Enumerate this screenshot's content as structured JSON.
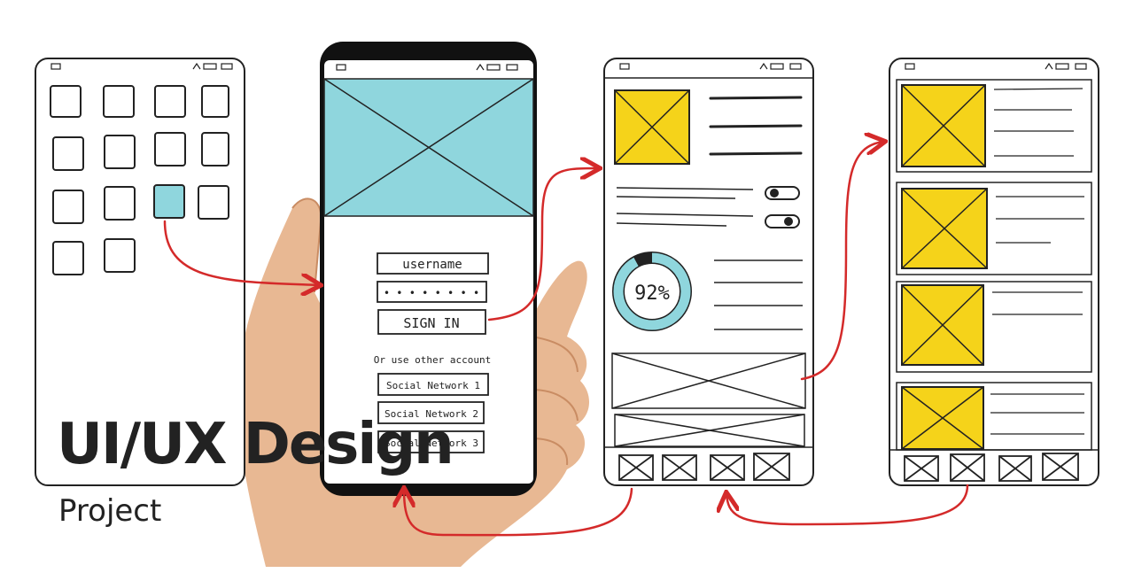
{
  "heading": {
    "title": "UI/UX Design",
    "subtitle": "Project"
  },
  "login_screen": {
    "username_field": "username",
    "password_field": "• • • • • • • •",
    "sign_in_button": "SIGN IN",
    "alt_text": "Or use other account",
    "social_buttons": [
      "Social Network 1",
      "Social Network 2",
      "Social Network 3"
    ]
  },
  "detail_screen": {
    "progress_label": "92%",
    "progress_value": 0.92
  },
  "colors": {
    "accent_teal": "#8fd6dd",
    "accent_yellow": "#f5d31a",
    "arrow_red": "#d42a2a",
    "skin": "#e8b893",
    "ink": "#222222"
  },
  "icons": [
    "status-bar-icon",
    "placeholder-image-icon",
    "toggle-icon",
    "arrow-icon"
  ]
}
